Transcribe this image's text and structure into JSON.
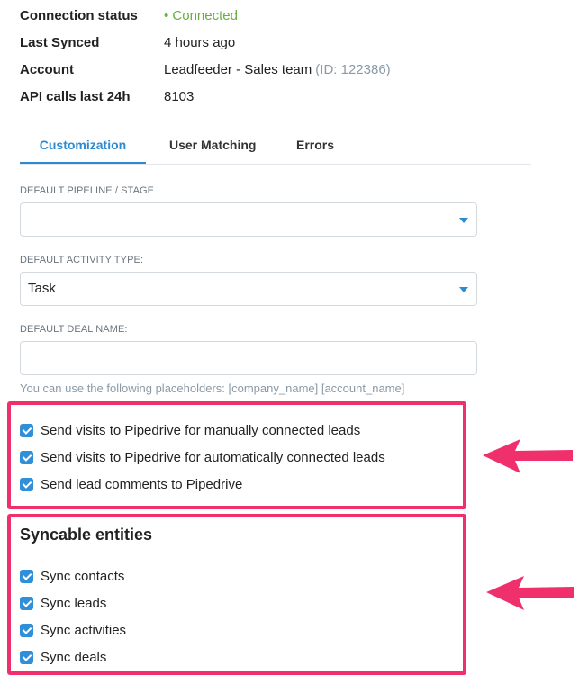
{
  "info": {
    "connection_status": {
      "label": "Connection status",
      "value": "• Connected"
    },
    "last_synced": {
      "label": "Last Synced",
      "value": "4 hours ago"
    },
    "account": {
      "label": "Account",
      "value": "Leadfeeder - Sales team",
      "id": "(ID: 122386)"
    },
    "api_calls": {
      "label": "API calls last 24h",
      "value": "8103"
    }
  },
  "tabs": [
    {
      "label": "Customization",
      "active": true
    },
    {
      "label": "User Matching",
      "active": false
    },
    {
      "label": "Errors",
      "active": false
    }
  ],
  "customization": {
    "pipeline": {
      "label": "DEFAULT PIPELINE / STAGE",
      "value": ""
    },
    "activity": {
      "label": "DEFAULT ACTIVITY TYPE:",
      "value": "Task"
    },
    "deal_name": {
      "label": "DEFAULT DEAL NAME:",
      "value": ""
    },
    "hint": "You can use the following placeholders: [company_name] [account_name]"
  },
  "send_options": [
    {
      "label": "Send visits to Pipedrive for manually connected leads",
      "checked": true
    },
    {
      "label": "Send visits to Pipedrive for automatically connected leads",
      "checked": true
    },
    {
      "label": "Send lead comments to Pipedrive",
      "checked": true
    }
  ],
  "syncable": {
    "title": "Syncable entities",
    "items": [
      {
        "label": "Sync contacts",
        "checked": true
      },
      {
        "label": "Sync leads",
        "checked": true
      },
      {
        "label": "Sync activities",
        "checked": true
      },
      {
        "label": "Sync deals",
        "checked": true
      }
    ]
  },
  "colors": {
    "accent": "#2c8bd1",
    "status": "#62b23c",
    "highlight": "#f0306c"
  },
  "icons": {
    "arrow": "left-arrow-icon",
    "caret": "caret-down-icon",
    "check": "checkbox-checked-icon"
  }
}
